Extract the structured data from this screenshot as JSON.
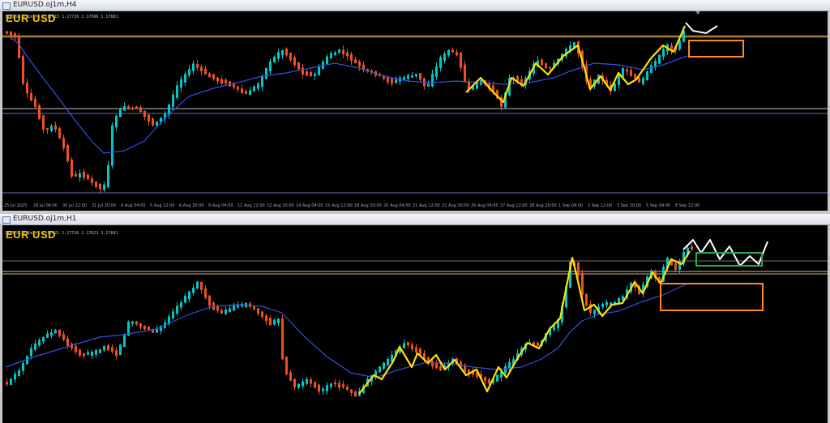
{
  "windows": [
    {
      "title": "EURUSD.oj1m,H4",
      "symbol": "EUR USD",
      "ohlc": "EURUSD.oj1m,H4  1.17615 1.17726 1.17566 1.17681",
      "time_labels": [
        "25 Jul 2025",
        "29 Jul 04:00",
        "30 Jul 12:00",
        "31 Jul 20:00",
        "4 Aug 04:00",
        "5 Aug 12:00",
        "6 Aug 20:00",
        "8 Aug 04:00",
        "11 Aug 12:00",
        "12 Aug 20:00",
        "14 Aug 04:00",
        "15 Aug 12:00",
        "18 Aug 20:00",
        "20 Aug 04:00",
        "21 Aug 12:00",
        "22 Aug 20:00",
        "26 Aug 04:00",
        "27 Aug 12:00",
        "28 Aug 20:00",
        "1 Sep 04:00",
        "2 Sep 12:00",
        "3 Sep 20:00",
        "5 Sep 04:00",
        "8 Sep 12:00"
      ]
    },
    {
      "title": "EURUSD.oj1m,H1",
      "symbol": "EUR USD",
      "ohlc": "EURUSD.oj1m,H1  1.17621 1.17726 1.17621 1.17681",
      "time_labels": [
        "",
        "",
        "",
        "",
        "",
        "",
        "",
        "",
        "",
        "",
        "",
        "",
        "",
        "",
        "",
        "",
        "",
        "",
        "",
        "",
        "",
        "",
        "",
        "",
        "",
        "",
        "",
        ""
      ]
    }
  ],
  "colors": {
    "bull": "#00c8c8",
    "bear": "#f0501e",
    "ma": "#3050e0",
    "zigzag": "#ffe000",
    "projection": "#ffffff",
    "level": "#a08040"
  }
}
